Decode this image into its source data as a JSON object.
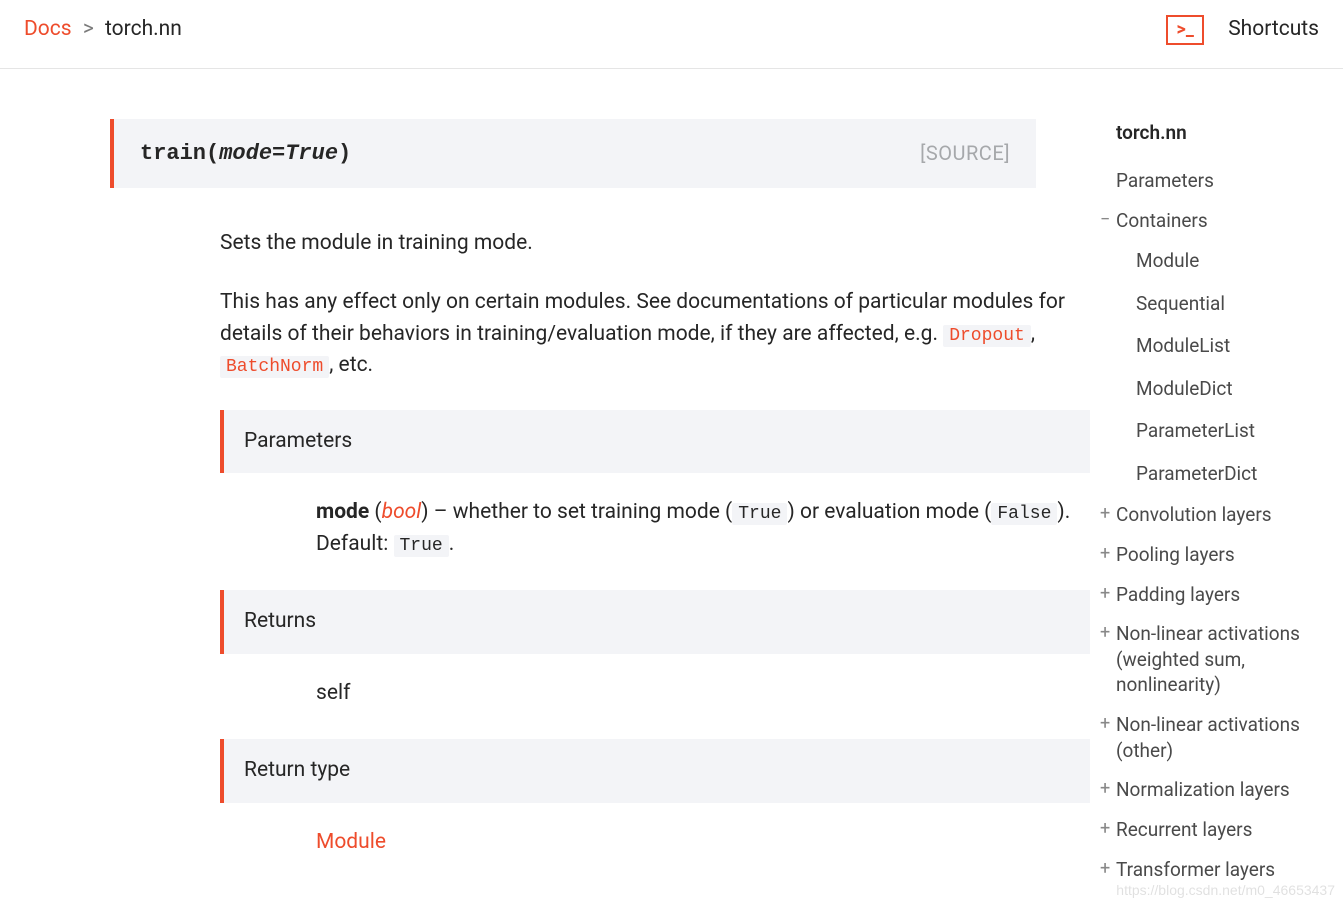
{
  "breadcrumb": {
    "root": "Docs",
    "sep": ">",
    "current": "torch.nn"
  },
  "shortcuts": {
    "label": "Shortcuts",
    "icon_glyph": ">_"
  },
  "signature": {
    "fn": "train",
    "open": "(",
    "param": "mode=True",
    "close": ")",
    "source_label": "[SOURCE]"
  },
  "paragraphs": {
    "p1": "Sets the module in training mode.",
    "p2a": "This has any effect only on certain modules. See documentations of particular modules for details of their behaviors in training/evaluation mode, if they are affected, e.g. ",
    "p2_code1": "Dropout",
    "p2_mid": ", ",
    "p2_code2": "BatchNorm",
    "p2b": ", etc."
  },
  "sections": {
    "parameters_title": "Parameters",
    "param": {
      "name": "mode",
      "open": " (",
      "type": "bool",
      "close": ") – whether to set training mode (",
      "true_code": "True",
      "mid": ") or evaluation mode (",
      "false_code": "False",
      "after": "). Default: ",
      "default_code": "True",
      "end": "."
    },
    "returns_title": "Returns",
    "returns_body": "self",
    "returntype_title": "Return type",
    "returntype_body": "Module"
  },
  "sidebar": {
    "top": "torch.nn",
    "items": [
      {
        "glyph": "",
        "label": "Parameters",
        "children": []
      },
      {
        "glyph": "−",
        "label": "Containers",
        "children": [
          "Module",
          "Sequential",
          "ModuleList",
          "ModuleDict",
          "ParameterList",
          "ParameterDict"
        ]
      },
      {
        "glyph": "+",
        "label": "Convolution layers",
        "children": []
      },
      {
        "glyph": "+",
        "label": "Pooling layers",
        "children": []
      },
      {
        "glyph": "+",
        "label": "Padding layers",
        "children": []
      },
      {
        "glyph": "+",
        "label": "Non-linear activations (weighted sum, nonlinearity)",
        "children": []
      },
      {
        "glyph": "+",
        "label": "Non-linear activations (other)",
        "children": []
      },
      {
        "glyph": "+",
        "label": "Normalization layers",
        "children": []
      },
      {
        "glyph": "+",
        "label": "Recurrent layers",
        "children": []
      },
      {
        "glyph": "+",
        "label": "Transformer layers",
        "children": []
      }
    ]
  },
  "watermark": "https://blog.csdn.net/m0_46653437"
}
